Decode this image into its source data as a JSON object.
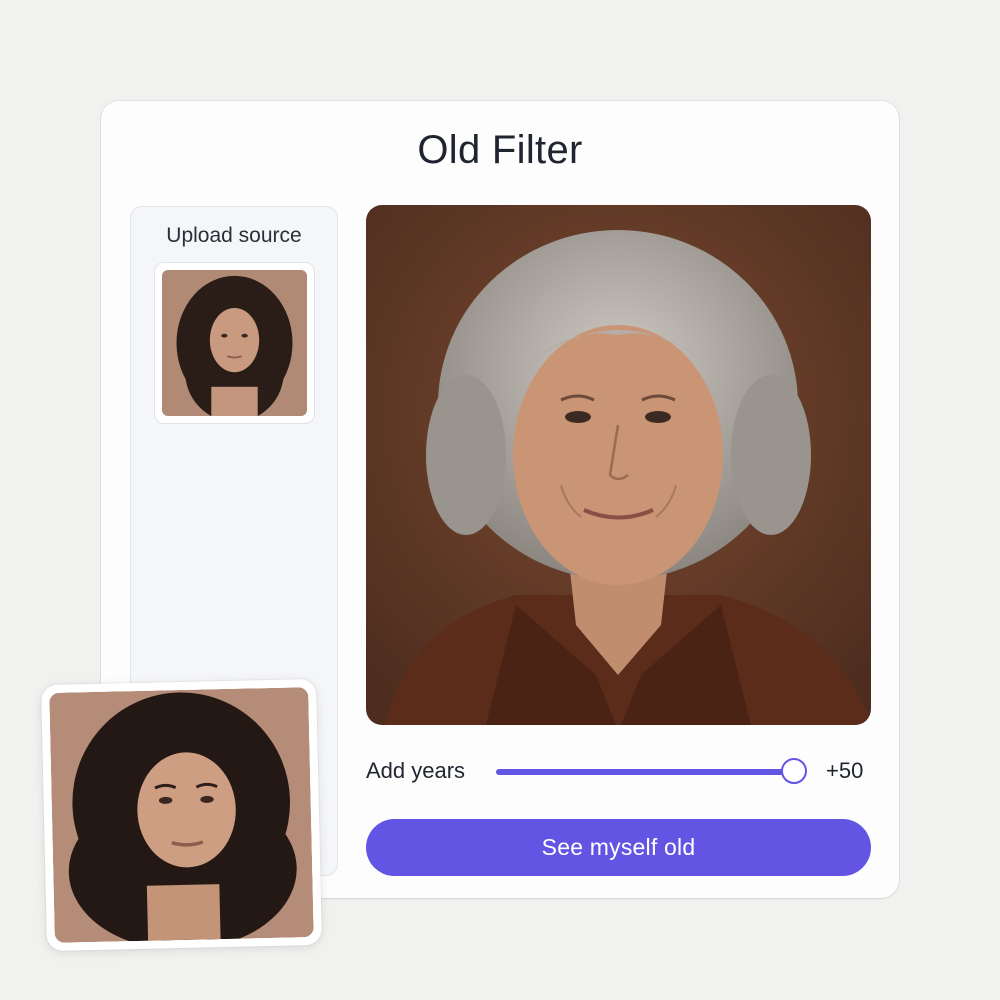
{
  "app": {
    "title": "Old Filter"
  },
  "sidebar": {
    "upload_label": "Upload source",
    "thumbnail": "source-portrait-thumbnail"
  },
  "result": {
    "image": "aged-portrait"
  },
  "slider": {
    "label": "Add years",
    "value_text": "+50",
    "value": 50,
    "fill_fraction": 0.97
  },
  "cta": {
    "label": "See myself old"
  },
  "floating_preview": {
    "image": "source-portrait"
  },
  "colors": {
    "accent": "#6255e3",
    "background": "#f1f1ef",
    "card": "#fdfdfd",
    "sidebar": "#f5f6f8"
  }
}
